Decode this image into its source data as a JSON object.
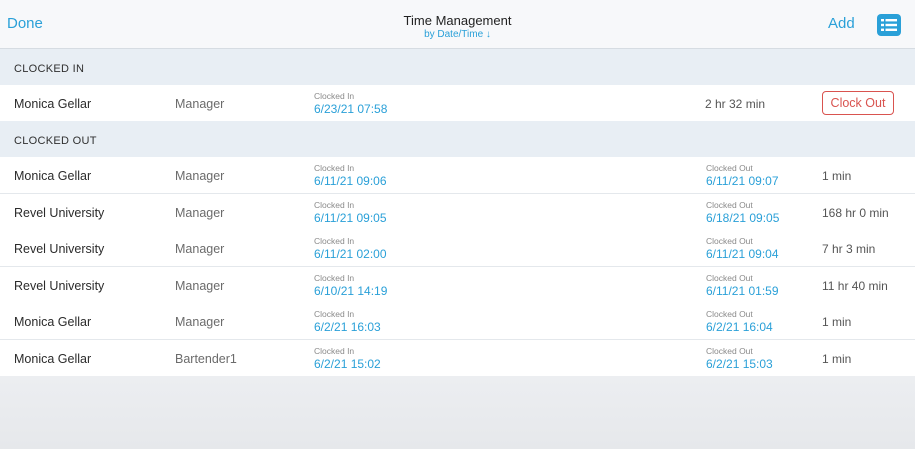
{
  "nav": {
    "done_label": "Done",
    "title": "Time Management",
    "subtitle": "by Date/Time ↓",
    "add_label": "Add"
  },
  "sections": {
    "clocked_in": "CLOCKED IN",
    "clocked_out": "CLOCKED OUT"
  },
  "labels": {
    "clocked_in": "Clocked In",
    "clocked_out": "Clocked Out",
    "clock_out_button": "Clock Out"
  },
  "clocked_in_rows": [
    {
      "name": "Monica Gellar",
      "role": "Manager",
      "in": "6/23/21 07:58",
      "duration": "2 hr 32 min"
    }
  ],
  "clocked_out_rows": [
    {
      "name": "Monica Gellar",
      "role": "Manager",
      "in": "6/11/21 09:06",
      "out": "6/11/21 09:07",
      "duration": "1 min"
    },
    {
      "name": "Revel University",
      "role": "Manager",
      "in": "6/11/21 09:05",
      "out": "6/18/21 09:05",
      "duration": "168 hr 0 min"
    },
    {
      "name": "Revel University",
      "role": "Manager",
      "in": "6/11/21 02:00",
      "out": "6/11/21 09:04",
      "duration": "7 hr 3 min"
    },
    {
      "name": "Revel University",
      "role": "Manager",
      "in": "6/10/21 14:19",
      "out": "6/11/21 01:59",
      "duration": "11 hr 40 min"
    },
    {
      "name": "Monica Gellar",
      "role": "Manager",
      "in": "6/2/21 16:03",
      "out": "6/2/21 16:04",
      "duration": "1 min"
    },
    {
      "name": "Monica Gellar",
      "role": "Bartender1",
      "in": "6/2/21 15:02",
      "out": "6/2/21 15:03",
      "duration": "1 min"
    }
  ],
  "icons": {
    "list": "list-icon"
  },
  "colors": {
    "accent": "#2aa0d8",
    "danger": "#d9534f"
  }
}
